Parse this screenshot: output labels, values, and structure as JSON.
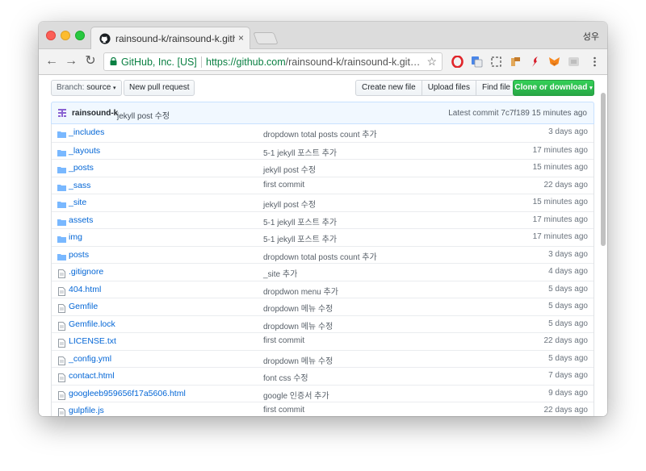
{
  "browser": {
    "tab_title": "rainsound-k/rainsound-k.github",
    "tab_close": "×",
    "profile_name": "성우",
    "ev_label": "GitHub, Inc. [US]",
    "url_scheme_host": "https://github.com",
    "url_path": "/rainsound-k/rainsound-k.git…",
    "star": "☆",
    "back": "←",
    "forward": "→",
    "reload": "↻"
  },
  "repo": {
    "branch_label": "Branch:",
    "branch_value": "source",
    "new_pull_request": "New pull request",
    "create_new_file": "Create new file",
    "upload_files": "Upload files",
    "find_file": "Find file",
    "clone_or_download": "Clone or download",
    "commit": {
      "author": "rainsound-k",
      "message": "jekyll post 수정",
      "latest": "Latest commit 7c7f189 15 minutes ago"
    },
    "files": [
      {
        "type": "dir",
        "name": "_includes",
        "message": "dropdown total posts count 추가",
        "age": "3 days ago"
      },
      {
        "type": "dir",
        "name": "_layouts",
        "message": "5-1 jekyll 포스트 추가",
        "age": "17 minutes ago"
      },
      {
        "type": "dir",
        "name": "_posts",
        "message": "jekyll post 수정",
        "age": "15 minutes ago"
      },
      {
        "type": "dir",
        "name": "_sass",
        "message": "first commit",
        "age": "22 days ago"
      },
      {
        "type": "dir",
        "name": "_site",
        "message": "jekyll post 수정",
        "age": "15 minutes ago"
      },
      {
        "type": "dir",
        "name": "assets",
        "message": "5-1 jekyll 포스트 추가",
        "age": "17 minutes ago"
      },
      {
        "type": "dir",
        "name": "img",
        "message": "5-1 jekyll 포스트 추가",
        "age": "17 minutes ago"
      },
      {
        "type": "dir",
        "name": "posts",
        "message": "dropdown total posts count 추가",
        "age": "3 days ago"
      },
      {
        "type": "file",
        "name": ".gitignore",
        "message": "_site 추가",
        "age": "4 days ago"
      },
      {
        "type": "file",
        "name": "404.html",
        "message": "dropdwon menu 추가",
        "age": "5 days ago"
      },
      {
        "type": "file",
        "name": "Gemfile",
        "message": "dropdown 메뉴 수정",
        "age": "5 days ago"
      },
      {
        "type": "file",
        "name": "Gemfile.lock",
        "message": "dropdown 메뉴 수정",
        "age": "5 days ago"
      },
      {
        "type": "file",
        "name": "LICENSE.txt",
        "message": "first commit",
        "age": "22 days ago"
      },
      {
        "type": "file",
        "name": "_config.yml",
        "message": "dropdown 메뉴 수정",
        "age": "5 days ago"
      },
      {
        "type": "file",
        "name": "contact.html",
        "message": "font css 수정",
        "age": "7 days ago"
      },
      {
        "type": "file",
        "name": "googleeb959656f17a5606.html",
        "message": "google 인증서 추가",
        "age": "9 days ago"
      },
      {
        "type": "file",
        "name": "gulpfile.js",
        "message": "first commit",
        "age": "22 days ago"
      }
    ]
  },
  "colors": {
    "link": "#0366d6",
    "folder": "#79b8ff",
    "clone_green": "#28a745",
    "commit_bar_bg": "#f1f8ff",
    "avatar_purple": "#8a63d2"
  }
}
